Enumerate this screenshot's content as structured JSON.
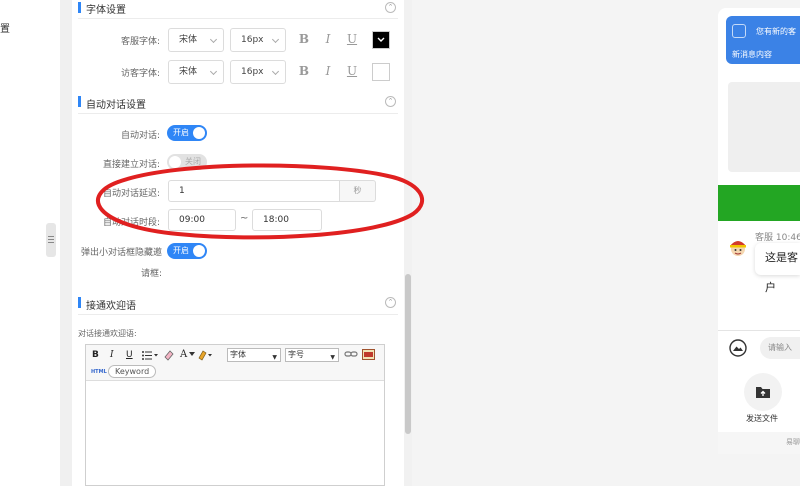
{
  "left_edge": {
    "fragment": "置"
  },
  "font_settings": {
    "title": "字体设置",
    "chevron": "⌃",
    "rows": [
      {
        "label": "客服字体:",
        "font": "宋体",
        "size": "16px",
        "bold": "B",
        "italic": "I",
        "underline": "U",
        "color_state": "black with dropdown",
        "color_hex": "#000000"
      },
      {
        "label": "访客字体:",
        "font": "宋体",
        "size": "16px",
        "bold": "B",
        "italic": "I",
        "underline": "U",
        "color_state": "white",
        "color_hex": "#ffffff"
      }
    ]
  },
  "auto_dialog": {
    "title": "自动对话设置",
    "chevron": "⌃",
    "auto_dialog": {
      "label": "自动对话:",
      "toggle_text": "开启",
      "state": "on"
    },
    "direct_establish": {
      "label": "直接建立对话:",
      "toggle_text": "关闭",
      "state": "off"
    },
    "delay": {
      "label": "自动对话延迟:",
      "value": "1",
      "unit": "秒"
    },
    "period": {
      "label": "自动对话时段:",
      "start": "09:00",
      "sep": "~",
      "end": "18:00"
    },
    "popup_hide": {
      "label_line1": "弹出小对话框隐藏邀",
      "label_line2": "请框:",
      "toggle_text": "开启",
      "state": "on"
    }
  },
  "welcome": {
    "title": "接通欢迎语",
    "chevron": "⌃",
    "field_label": "对话接通欢迎语:",
    "toolbar": {
      "bold": "B",
      "italic": "I",
      "underline": "U",
      "fontcolor": "A",
      "font_select": "字体",
      "size_select": "字号",
      "html_label": "HTML",
      "keyword_label": "Keyword"
    }
  },
  "preview": {
    "notification_title": "您有新的客",
    "notification_body": "新消息内容",
    "agent_name": "客服",
    "agent_time": "10:46",
    "message": "这是客户",
    "input_placeholder": "请输入",
    "send_file_label": "发送文件",
    "footer_text": "易聊"
  },
  "colors": {
    "accent": "#2f86f6",
    "annotation_red": "#e02020",
    "notification_blue": "#3b82e6",
    "green_bar": "#23a623"
  }
}
